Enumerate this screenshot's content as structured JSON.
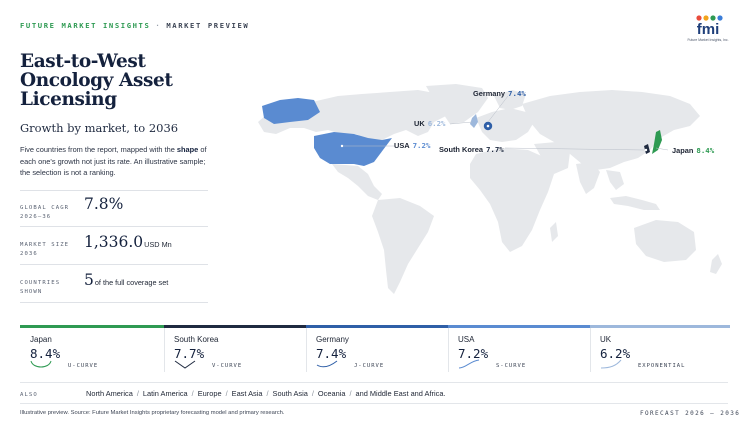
{
  "header": {
    "brand": "FUTURE MARKET INSIGHTS",
    "separator": "·",
    "label": "MARKET PREVIEW",
    "logo_text": "fmi",
    "logo_tagline": "Future Market Insights, Inc."
  },
  "title": "East-to-West Oncology Asset Licensing",
  "subtitle": "Growth by market, to 2036",
  "description": {
    "part1": "Five countries from the report, mapped with the ",
    "bold": "shape",
    "part2": " of each one's growth not just its rate. An illustrative sample; the selection is not a ranking."
  },
  "stats": [
    {
      "label": "GLOBAL CAGR 2026–36",
      "value": "7.8%",
      "unit": ""
    },
    {
      "label": "MARKET SIZE 2036",
      "value": "1,336.0",
      "unit": "USD Mn"
    },
    {
      "label": "COUNTRIES SHOWN",
      "value": "5",
      "unit": "of the full coverage set"
    }
  ],
  "map_labels": [
    {
      "country": "Germany",
      "value": "7.4%",
      "color": "#2f5fa7"
    },
    {
      "country": "UK",
      "value": "6.2%",
      "color": "#9db8dc"
    },
    {
      "country": "USA",
      "value": "7.2%",
      "color": "#5a8bd1"
    },
    {
      "country": "South Korea",
      "value": "7.7%",
      "color": "#1f2a40"
    },
    {
      "country": "Japan",
      "value": "8.4%",
      "color": "#2e9a52"
    }
  ],
  "cards": [
    {
      "name": "Japan",
      "value": "8.4%",
      "shape": "U-CURVE",
      "color": "#2e9a52",
      "icon": "u-curve-icon"
    },
    {
      "name": "South Korea",
      "value": "7.7%",
      "shape": "V-CURVE",
      "color": "#1f2a40",
      "icon": "v-curve-icon"
    },
    {
      "name": "Germany",
      "value": "7.4%",
      "shape": "J-CURVE",
      "color": "#2f5fa7",
      "icon": "j-curve-icon"
    },
    {
      "name": "USA",
      "value": "7.2%",
      "shape": "S-CURVE",
      "color": "#5a8bd1",
      "icon": "s-curve-icon"
    },
    {
      "name": "UK",
      "value": "6.2%",
      "shape": "EXPONENTIAL",
      "color": "#9db8dc",
      "icon": "exponential-curve-icon"
    }
  ],
  "also": {
    "label": "ALSO",
    "regions": [
      "North America",
      "Latin America",
      "Europe",
      "East Asia",
      "South Asia",
      "Oceania",
      "and Middle East and Africa."
    ]
  },
  "footer": {
    "note": "Illustrative preview. Source: Future Market Insights proprietary forecasting model and primary research.",
    "forecast": "FORECAST 2026 – 2036"
  },
  "colors": {
    "land": "#e6e8eb",
    "accent_green": "#2e9a52",
    "navy": "#14213d"
  }
}
